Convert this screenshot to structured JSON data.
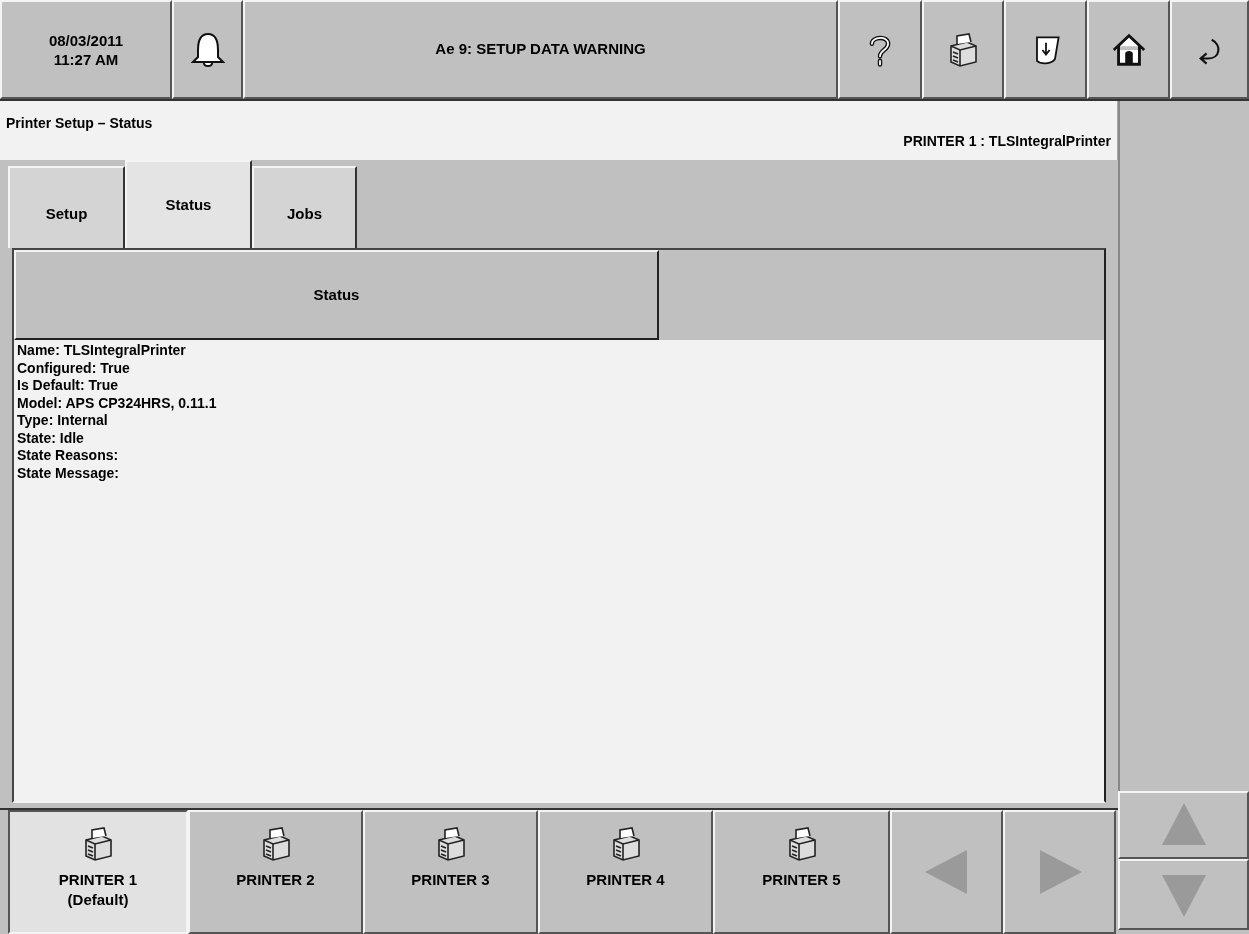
{
  "header": {
    "date": "08/03/2011",
    "time": "11:27 AM",
    "alarm_message": "Ae 9: SETUP DATA WARNING"
  },
  "page": {
    "title": "Printer Setup – Status",
    "printer_label": "PRINTER 1 : TLSIntegralPrinter"
  },
  "tabs": [
    {
      "label": "Setup",
      "selected": false
    },
    {
      "label": "Status",
      "selected": true
    },
    {
      "label": "Jobs",
      "selected": false
    }
  ],
  "table": {
    "columns": [
      "Status"
    ],
    "lines": [
      "Name: TLSIntegralPrinter",
      "Configured: True",
      "Is Default: True",
      "Model: APS CP324HRS, 0.11.1",
      "Type: Internal",
      "State: Idle",
      "State Reasons:",
      "State Message:"
    ]
  },
  "printers": [
    {
      "label": "PRINTER 1",
      "sublabel": "(Default)",
      "selected": true
    },
    {
      "label": "PRINTER 2",
      "selected": false
    },
    {
      "label": "PRINTER 3",
      "selected": false
    },
    {
      "label": "PRINTER 4",
      "selected": false
    },
    {
      "label": "PRINTER 5",
      "selected": false
    }
  ],
  "nav": {
    "left_disabled": true,
    "right_disabled": true,
    "up_disabled": true,
    "down_disabled": true
  }
}
